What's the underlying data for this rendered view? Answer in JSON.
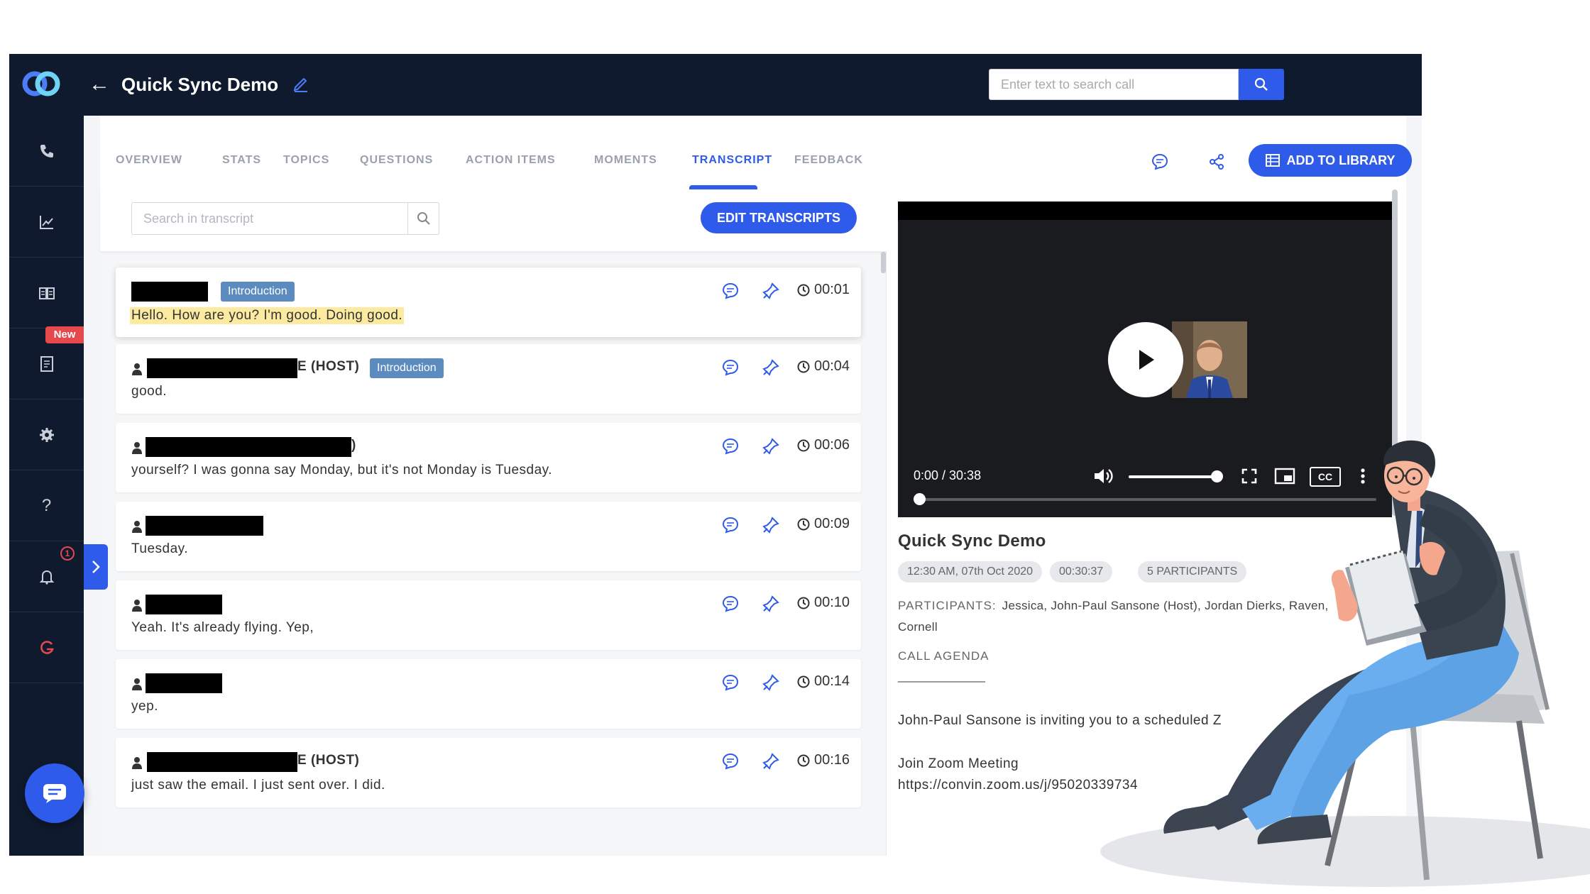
{
  "header": {
    "title": "Quick Sync Demo",
    "search_placeholder": "Enter text to search call"
  },
  "sidebar": {
    "items": [
      "phone-icon",
      "stats-chart-icon",
      "book-icon",
      "report-icon",
      "gear-icon",
      "help-icon",
      "bell-icon",
      "g-logo-icon"
    ],
    "new_badge": "New",
    "notification_count": "1"
  },
  "tabs": [
    "OVERVIEW",
    "STATS",
    "TOPICS",
    "QUESTIONS",
    "ACTION ITEMS",
    "MOMENTS",
    "TRANSCRIPT",
    "FEEDBACK"
  ],
  "active_tab": "TRANSCRIPT",
  "actions": {
    "add_to_library": "ADD TO LIBRARY"
  },
  "transcript": {
    "search_placeholder": "Search in transcript",
    "edit_button": "EDIT TRANSCRIPTS",
    "entries": [
      {
        "speaker_suffix": "",
        "tag": "Introduction",
        "time": "00:01",
        "text": "Hello. How are you? I'm good. Doing good."
      },
      {
        "speaker_suffix": "E (HOST)",
        "tag": "Introduction",
        "time": "00:04",
        "text": "good."
      },
      {
        "speaker_suffix": ")",
        "tag": "",
        "time": "00:06",
        "text": "yourself? I was gonna say Monday, but it's not Monday is Tuesday."
      },
      {
        "speaker_suffix": "",
        "tag": "",
        "time": "00:09",
        "text": "Tuesday."
      },
      {
        "speaker_suffix": "",
        "tag": "",
        "time": "00:10",
        "text": "Yeah. It's already flying. Yep,"
      },
      {
        "speaker_suffix": "",
        "tag": "",
        "time": "00:14",
        "text": "yep."
      },
      {
        "speaker_suffix": "E (HOST)",
        "tag": "",
        "time": "00:16",
        "text": "just saw the email. I just sent over. I did."
      }
    ]
  },
  "player": {
    "time": "0:00 / 30:38",
    "volume_fraction": 0.95,
    "progress_fraction": 0.0,
    "cc_label": "CC"
  },
  "meta": {
    "title": "Quick Sync Demo",
    "date": "12:30 AM, 07th Oct 2020",
    "duration": "00:30:37",
    "participants_count": "5 PARTICIPANTS",
    "participants_label": "PARTICIPANTS:",
    "participants": "Jessica, John-Paul Sansone (Host), Jordan Dierks, Raven, Cornell",
    "agenda_label": "CALL AGENDA",
    "agenda_line": "_____________",
    "agenda_text_1": "John-Paul Sansone is inviting you to a scheduled Z",
    "agenda_text_2": "Join Zoom Meeting",
    "agenda_text_3": "https://convin.zoom.us/j/95020339734"
  },
  "colors": {
    "navy": "#0f1a2e",
    "accent": "#2f5bea",
    "tag": "#5b8bbf",
    "highlight": "#fbeaa0",
    "alert": "#e5484d"
  }
}
